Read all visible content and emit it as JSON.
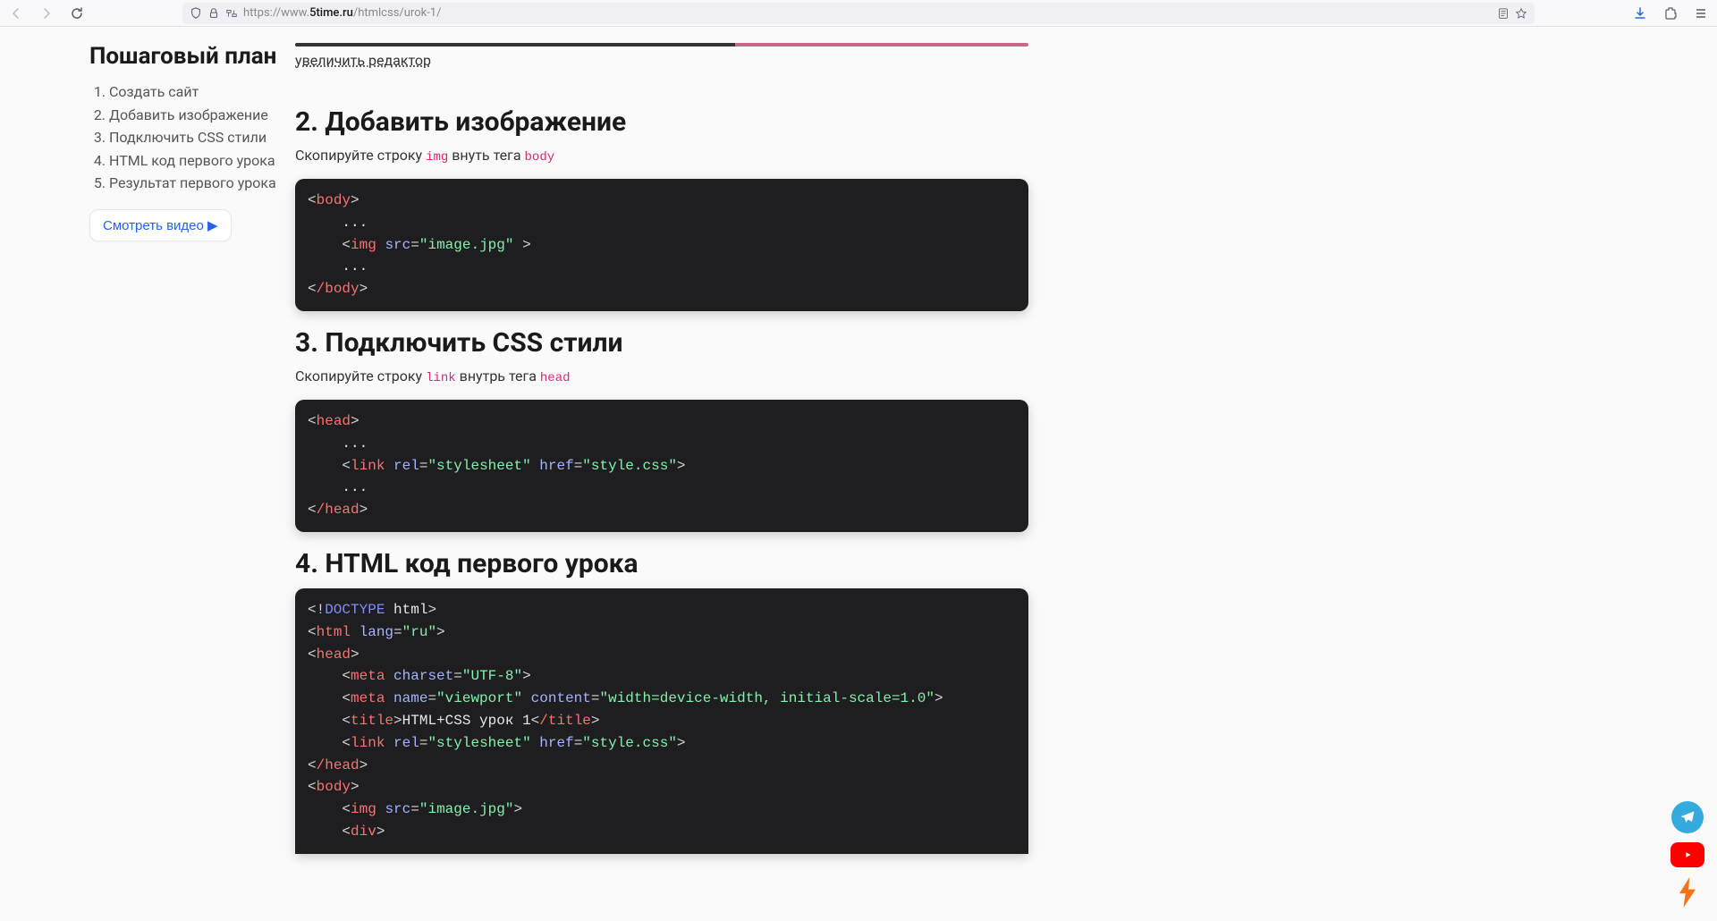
{
  "browser": {
    "url_prefix": "https://www.",
    "url_bold": "5time.ru",
    "url_suffix": "/htmlcss/urok-1/"
  },
  "sidebar": {
    "title": "Пошаговый план",
    "items": [
      {
        "label": "Создать сайт"
      },
      {
        "label": "Добавить изображение"
      },
      {
        "label": "Подключить CSS стили"
      },
      {
        "label": "HTML код первого урока"
      },
      {
        "label": "Результат первого урока"
      }
    ],
    "watch_video": "Смотреть видео ▶"
  },
  "main": {
    "enlarge_editor": "увеличить редактор",
    "section2": {
      "heading": "2. Добавить изображение",
      "desc_before": "Скопируйте строку ",
      "code1": "img",
      "desc_mid": " внуть тега ",
      "code2": "body"
    },
    "section3": {
      "heading": "3. Подключить CSS стили",
      "desc_before": "Скопируйте строку ",
      "code1": "link",
      "desc_mid": " внутрь тега ",
      "code2": "head"
    },
    "section4": {
      "heading": "4. HTML код первого урока"
    },
    "code_strings": {
      "image_jpg": "\"image.jpg\"",
      "stylesheet": "\"stylesheet\"",
      "style_css": "\"style.css\"",
      "ru": "\"ru\"",
      "utf8": "\"UTF-8\"",
      "viewport": "\"viewport\"",
      "viewport_content": "\"width=device-width, initial-scale=1.0\"",
      "title_text": "HTML+CSS урок 1",
      "ellipsis": "...",
      "body_open": "body",
      "body_close": "/body",
      "head_open": "head",
      "head_close": "/head",
      "img": "img",
      "src": "src",
      "link": "link",
      "rel": "rel",
      "href": "href",
      "doctype": "DOCTYPE",
      "html": "html",
      "lang": "lang",
      "meta": "meta",
      "charset": "charset",
      "name": "name",
      "content": "content",
      "title": "title",
      "title_close": "/title",
      "div": "div"
    }
  }
}
